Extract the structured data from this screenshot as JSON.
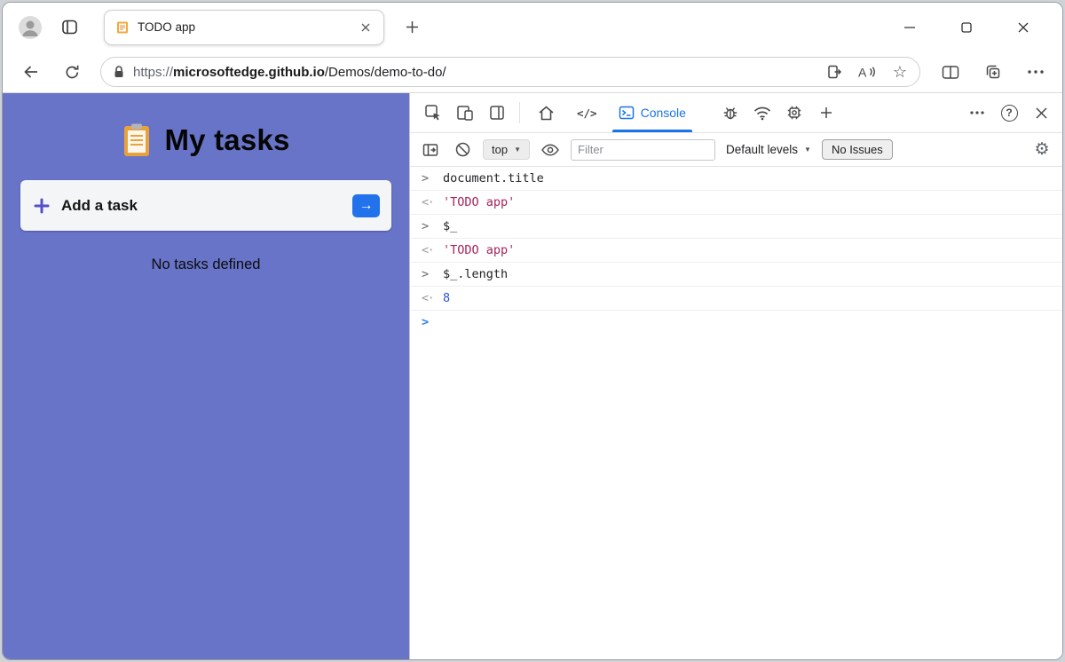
{
  "browser": {
    "tab_title": "TODO app",
    "url_scheme": "https://",
    "url_host": "microsoftedge.github.io",
    "url_path": "/Demos/demo-to-do/"
  },
  "todo": {
    "title": "My tasks",
    "add_task_label": "Add a task",
    "empty_message": "No tasks defined"
  },
  "devtools": {
    "console_tab_label": "Console",
    "context_selector": "top",
    "filter_placeholder": "Filter",
    "levels_label": "Default levels",
    "no_issues_label": "No Issues",
    "entries": [
      {
        "prompt": ">",
        "text": "document.title",
        "kind": "input"
      },
      {
        "prompt": "<·",
        "text": "'TODO app'",
        "kind": "string-result"
      },
      {
        "prompt": ">",
        "text": "$_",
        "kind": "input"
      },
      {
        "prompt": "<·",
        "text": "'TODO app'",
        "kind": "string-result"
      },
      {
        "prompt": ">",
        "text": "$_.length",
        "kind": "input"
      },
      {
        "prompt": "<·",
        "text": "8",
        "kind": "number-result"
      },
      {
        "prompt": ">",
        "text": "",
        "kind": "prompt"
      }
    ]
  },
  "icons": {
    "caret_down": "▼",
    "star": "☆",
    "gear": "⚙",
    "help": "?",
    "code": "</>",
    "go_arrow": "→"
  },
  "colors": {
    "todo_background": "#6874c8",
    "accent_blue": "#2272eb",
    "devtools_active_tab": "#1a73e8",
    "console_string": "#a5245c",
    "console_number": "#2b53d0"
  }
}
